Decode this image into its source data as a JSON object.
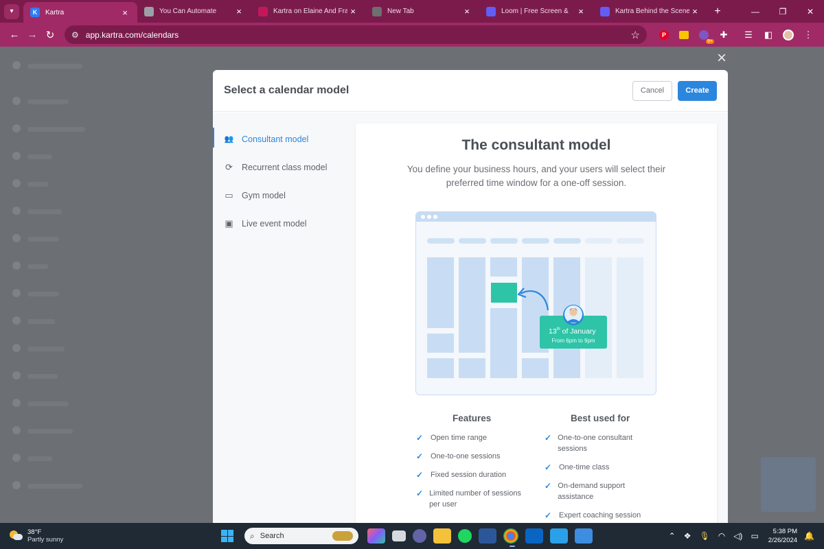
{
  "browser": {
    "tabs": [
      {
        "title": "Kartra",
        "favicon_color": "#2e7cf6",
        "favicon_letter": "K",
        "active": true
      },
      {
        "title": "You Can Automate",
        "favicon_color": "#9aa0a6",
        "favicon_letter": "",
        "active": false
      },
      {
        "title": "Kartra on Elaine And Fran",
        "favicon_color": "#c2185b",
        "favicon_letter": "",
        "active": false
      },
      {
        "title": "New Tab",
        "favicon_color": "#6f6f6f",
        "favicon_letter": "",
        "active": false
      },
      {
        "title": "Loom | Free Screen &",
        "favicon_color": "#625df5",
        "favicon_letter": "",
        "active": false
      },
      {
        "title": "Kartra Behind the Scenes",
        "favicon_color": "#625df5",
        "favicon_letter": "",
        "active": false
      }
    ],
    "url": "app.kartra.com/calendars",
    "extension_badge": "9+"
  },
  "modal": {
    "title": "Select a calendar model",
    "cancel_label": "Cancel",
    "create_label": "Create",
    "models": [
      {
        "label": "Consultant model",
        "icon": "users-icon",
        "active": true
      },
      {
        "label": "Recurrent class model",
        "icon": "refresh-icon",
        "active": false
      },
      {
        "label": "Gym model",
        "icon": "calendar-icon",
        "active": false
      },
      {
        "label": "Live event model",
        "icon": "calendar-event-icon",
        "active": false
      }
    ],
    "detail": {
      "title": "The consultant model",
      "description": "You define your business hours, and your users will select their preferred time window for a one-off session.",
      "illustration": {
        "date_day": "13",
        "date_suffix": "th",
        "date_rest": " of January",
        "time_range": "From 6pm to 9pm"
      },
      "features_heading": "Features",
      "features": [
        "Open time range",
        "One-to-one sessions",
        "Fixed session duration",
        "Limited number of sessions per user"
      ],
      "best_used_heading": "Best used for",
      "best_used": [
        "One-to-one consultant sessions",
        "One-time class",
        "On-demand support assistance",
        "Expert coaching session"
      ]
    }
  },
  "taskbar": {
    "weather_temp": "38°F",
    "weather_desc": "Partly sunny",
    "search_placeholder": "Search",
    "time": "5:38 PM",
    "date": "2/26/2024"
  },
  "colors": {
    "accent": "#2b86de",
    "brand_chrome": "#a02a66",
    "teal": "#2ec4a7"
  }
}
